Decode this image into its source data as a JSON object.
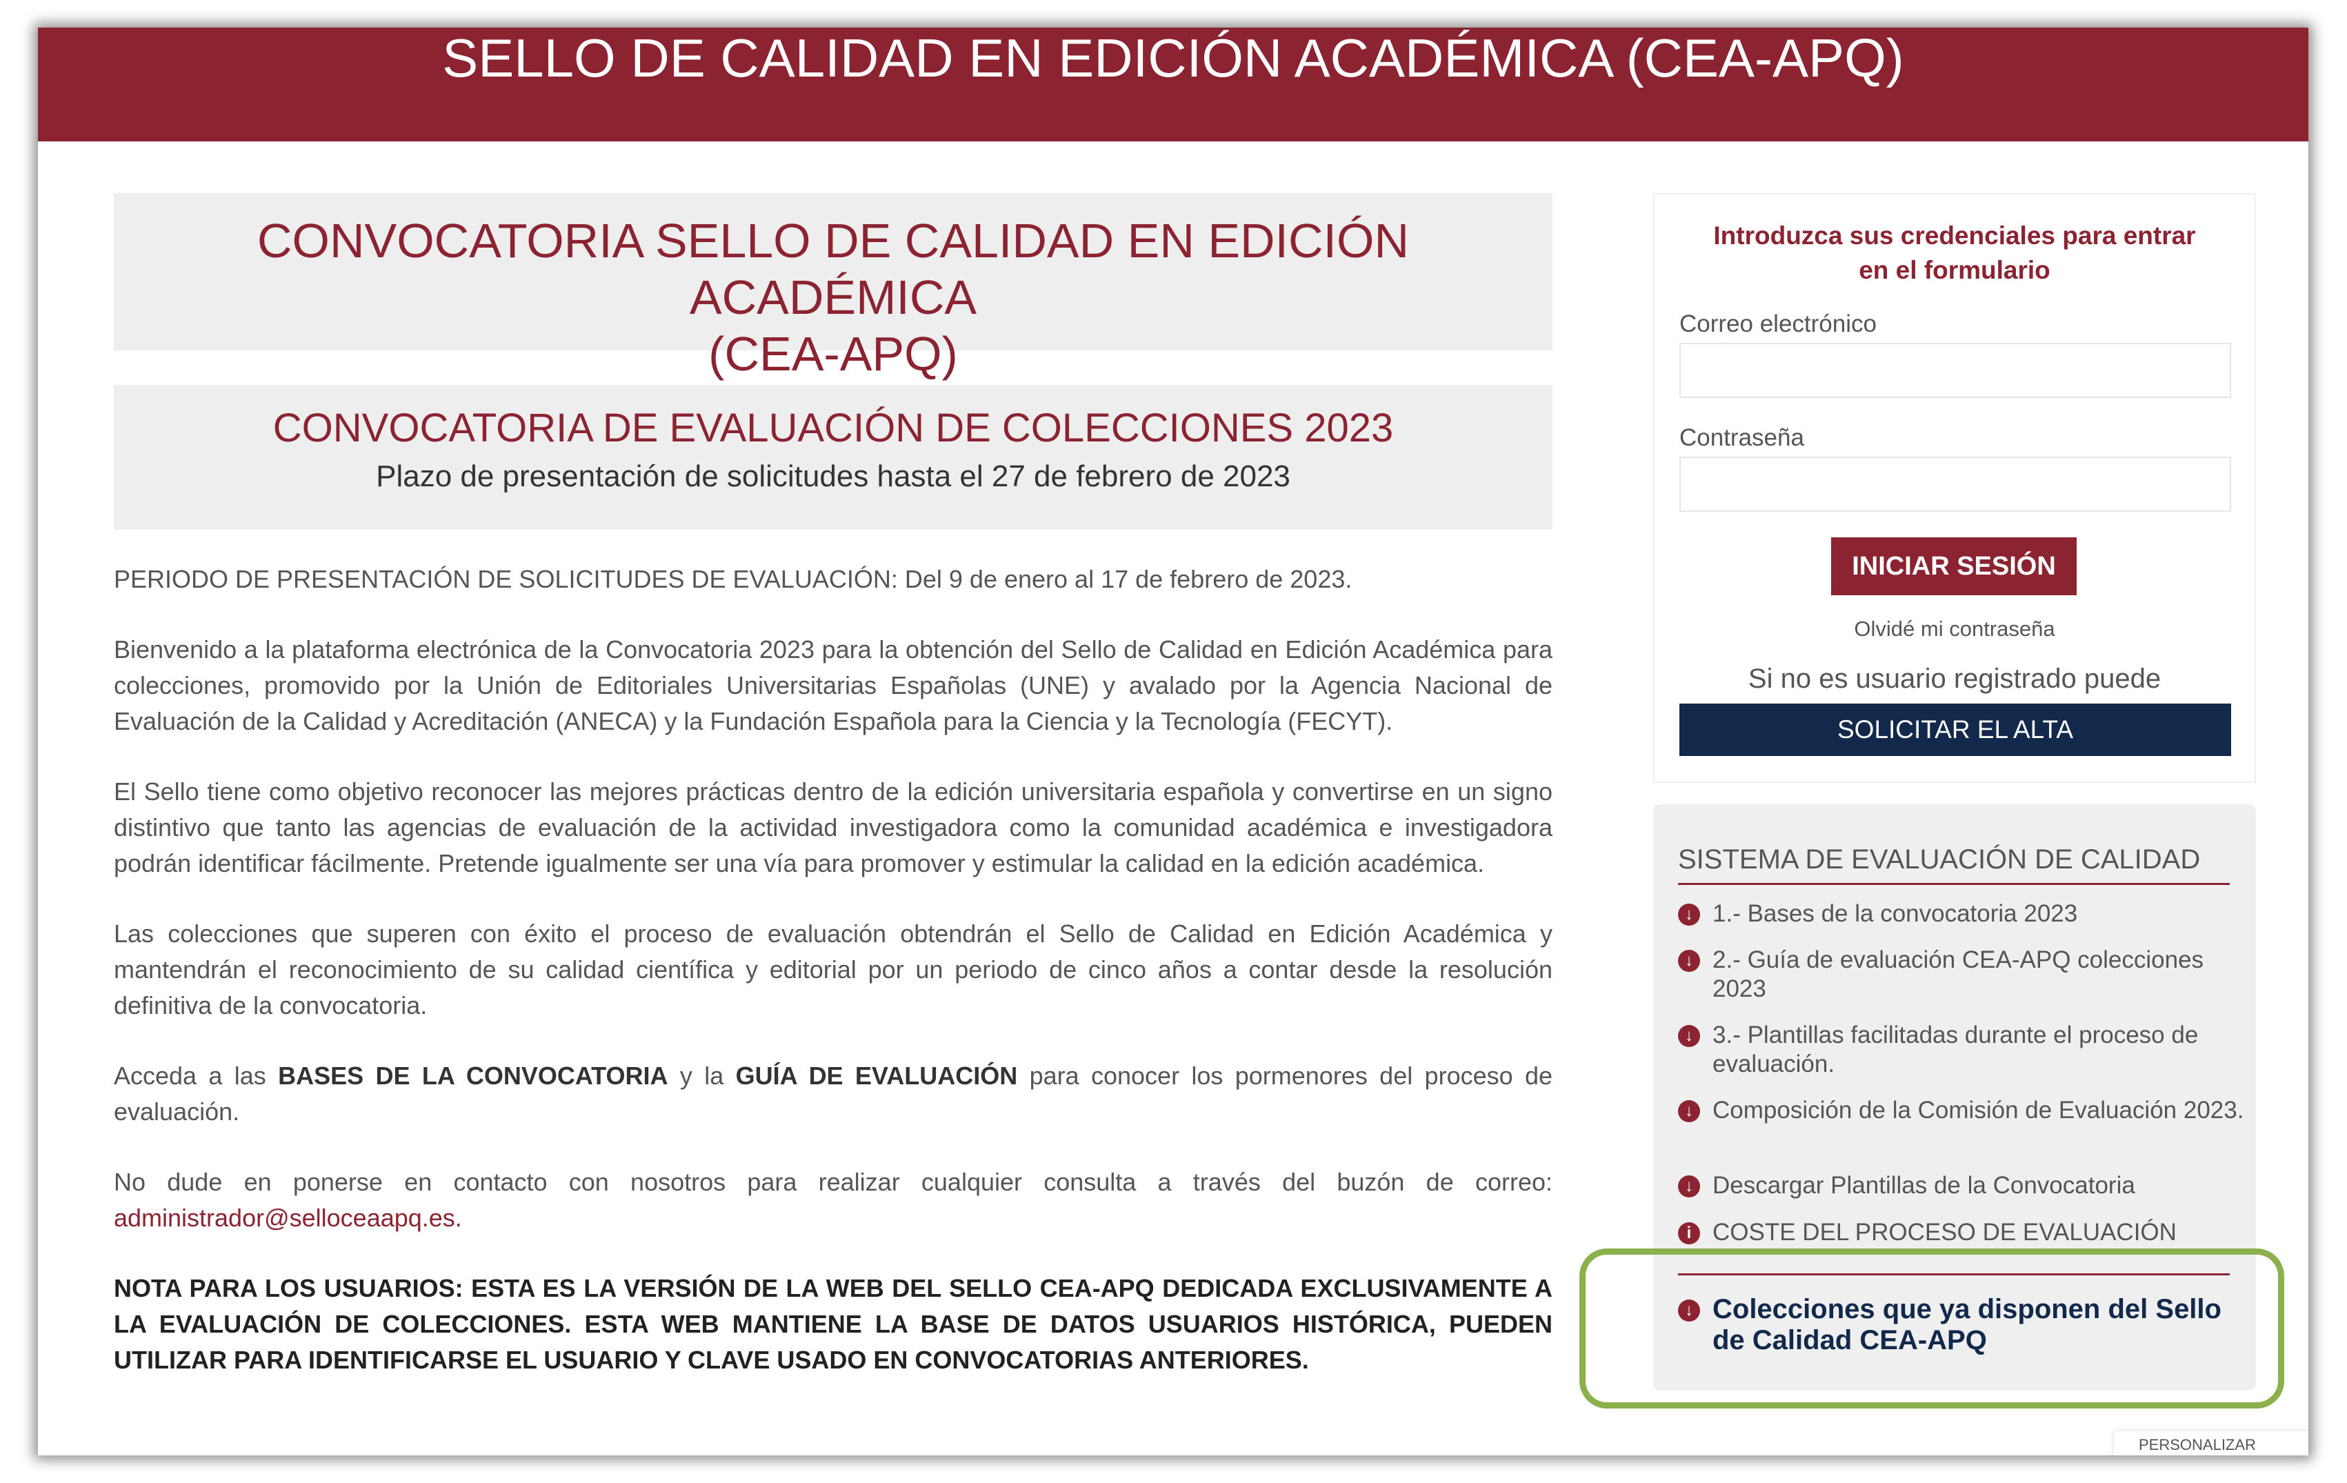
{
  "header": {
    "title": "SELLO DE CALIDAD EN EDICIÓN ACADÉMICA (CEA-APQ)"
  },
  "hero": {
    "title_line1": "CONVOCATORIA SELLO DE CALIDAD EN EDICIÓN ACADÉMICA",
    "title_line2": "(CEA-APQ)",
    "call_title": "CONVOCATORIA DE EVALUACIÓN DE COLECCIONES 2023",
    "call_subtitle": "Plazo de presentación de solicitudes hasta el 27 de febrero de 2023"
  },
  "content": {
    "period": "PERIODO DE PRESENTACIÓN DE SOLICITUDES DE EVALUACIÓN: Del 9 de enero al 17 de febrero de 2023.",
    "welcome": "Bienvenido a la plataforma electrónica de la Convocatoria 2023 para la obtención del Sello de Calidad en Edición Académica para colecciones, promovido por la Unión de Editoriales Universitarias Españolas (UNE) y avalado por la Agencia Nacional de Evaluación de la Calidad y Acreditación (ANECA) y la Fundación Española para la Ciencia y la Tecnología (FECYT).",
    "objective": "El Sello tiene como objetivo reconocer las mejores prácticas dentro de la edición universitaria española y convertirse en un signo distintivo que tanto las agencias de evaluación de la actividad investigadora como la comunidad académica e investigadora podrán identificar fácilmente. Pretende igualmente ser una vía para promover y estimular la calidad en la edición académica.",
    "collections": "Las colecciones que superen con éxito el proceso de evaluación obtendrán el Sello de Calidad en Edición Académica y mantendrán el reconocimiento de su calidad científica y editorial por un periodo de cinco años a contar desde la resolución definitiva de la convocatoria.",
    "access_prefix": "Acceda a las ",
    "access_bases": "BASES DE LA CONVOCATORIA",
    "access_middle": " y la ",
    "access_guide": "GUÍA DE EVALUACIÓN",
    "access_suffix": " para conocer los pormenores del proceso de evaluación.",
    "contact_prefix": "No dude en ponerse en contacto con nosotros para realizar cualquier consulta a través del buzón de correo: ",
    "contact_email": "administrador@selloceaapq.es.",
    "note": "NOTA PARA LOS USUARIOS: ESTA ES LA VERSIÓN DE LA WEB DEL SELLO CEA-APQ DEDICADA EXCLUSIVAMENTE A LA EVALUACIÓN DE COLECCIONES. ESTA WEB MANTIENE LA BASE DE DATOS USUARIOS HISTÓRICA, PUEDEN UTILIZAR PARA IDENTIFICARSE EL USUARIO Y CLAVE USADO EN CONVOCATORIAS ANTERIORES."
  },
  "login": {
    "heading_line1": "Introduzca sus credenciales para entrar",
    "heading_line2": "en el formulario",
    "email_label": "Correo electrónico",
    "email_value": "",
    "password_label": "Contraseña",
    "password_value": "",
    "submit_label": "INICIAR SESIÓN",
    "forgot_label": "Olvidé mi contraseña",
    "not_registered": "Si no es usuario registrado puede",
    "register_label": "SOLICITAR EL ALTA"
  },
  "quality_system": {
    "title": "SISTEMA DE EVALUACIÓN DE CALIDAD",
    "items": [
      {
        "label": "1.- Bases de la convocatoria 2023",
        "icon": "download-icon"
      },
      {
        "label": "2.- Guía de evaluación CEA-APQ colecciones 2023",
        "icon": "download-icon"
      },
      {
        "label": "3.- Plantillas facilitadas durante el proceso de evaluación.",
        "icon": "download-icon"
      },
      {
        "label": "Composición de la Comisión de Evaluación 2023.",
        "icon": "download-icon"
      },
      {
        "label": "Descargar Plantillas de la Convocatoria",
        "icon": "download-icon"
      },
      {
        "label": "COSTE DEL PROCESO DE EVALUACIÓN",
        "icon": "info-icon"
      }
    ],
    "featured": {
      "label": "Colecciones que ya disponen del Sello de Calidad CEA-APQ",
      "icon": "download-icon"
    }
  },
  "cookie_bar": {
    "label": "PERSONALIZAR"
  },
  "colors": {
    "brand": "#8b2331",
    "navy": "#13294b",
    "highlight": "#8cb04c"
  }
}
